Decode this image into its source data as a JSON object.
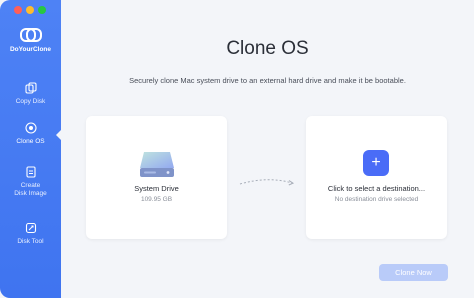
{
  "app": {
    "brand": "DoYourClone"
  },
  "sidebar": {
    "items": [
      {
        "label": "Copy Disk",
        "icon": "copy-disk-icon",
        "active": false
      },
      {
        "label": "Clone OS",
        "icon": "clone-os-icon",
        "active": true
      },
      {
        "label_line1": "Create",
        "label_line2": "Disk Image",
        "icon": "disk-image-icon",
        "active": false
      },
      {
        "label": "Disk Tool",
        "icon": "disk-tool-icon",
        "active": false
      }
    ]
  },
  "main": {
    "title": "Clone OS",
    "subtitle": "Securely clone Mac system drive to an external hard drive and make it be bootable."
  },
  "source": {
    "name": "System Drive",
    "size": "109.95 GB",
    "icon": "hard-drive-icon"
  },
  "destination": {
    "title": "Click to select a destination...",
    "subtitle": "No destination drive selected",
    "icon": "plus-icon"
  },
  "actions": {
    "clone_label": "Clone Now",
    "clone_enabled": false
  },
  "colors": {
    "sidebar": "#4e82f5",
    "accent": "#4a6cf7",
    "button_disabled": "#b9cbf9"
  }
}
